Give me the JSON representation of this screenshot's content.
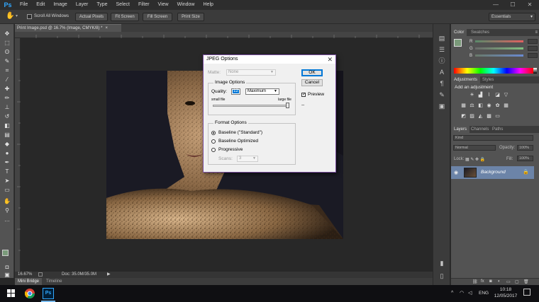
{
  "menubar": {
    "logo": "Ps",
    "items": [
      "File",
      "Edit",
      "Image",
      "Layer",
      "Type",
      "Select",
      "Filter",
      "View",
      "Window",
      "Help"
    ],
    "minimize": "—",
    "maximize": "☐",
    "close": "✕"
  },
  "options_bar": {
    "scroll_all_label": "Scroll All Windows",
    "buttons": [
      "Actual Pixels",
      "Fit Screen",
      "Fill Screen",
      "Print Size"
    ],
    "workspace": "Essentials"
  },
  "document": {
    "tab_title": "Print Image.psd @ 16.7% (Image, CMYK/8) *",
    "zoom": "16.67%",
    "doc_info": "Doc: 35.0M/35.0M"
  },
  "bottom_tabs": [
    "Mini Bridge",
    "Timeline"
  ],
  "colors": {
    "accent": "#31a8ff",
    "dialog_border": "#7a4fa0",
    "layer_selected": "#6c84a8"
  },
  "panels": {
    "color_tabs": [
      "Color",
      "Swatches"
    ],
    "sliders": [
      "R",
      "G",
      "B"
    ],
    "adjust_tabs": [
      "Adjustments",
      "Styles"
    ],
    "adjust_heading": "Add an adjustment",
    "layers_tabs": [
      "Layers",
      "Channels",
      "Paths"
    ],
    "kind": "Kind",
    "blend": "Normal",
    "opacity_label": "Opacity:",
    "opacity_value": "100%",
    "lock_label": "Lock:",
    "fill_label": "Fill:",
    "fill_value": "100%",
    "layer_name": "Background"
  },
  "dialog": {
    "title": "JPEG Options",
    "matte_label": "Matte:",
    "matte_value": "None",
    "ok": "OK",
    "cancel": "Cancel",
    "preview_label": "Preview",
    "image_options_legend": "Image Options",
    "quality_label": "Quality:",
    "quality_value": "12",
    "quality_preset": "Maximum",
    "small_file": "small file",
    "large_file": "large file",
    "slider_fraction": 1.0,
    "size_readout": "--",
    "format_legend": "Format Options",
    "formats": [
      "Baseline (\"Standard\")",
      "Baseline Optimized",
      "Progressive"
    ],
    "scans_label": "Scans:",
    "scans_value": "3"
  },
  "taskbar": {
    "language": "ENG",
    "time": "10:18",
    "date": "12/05/2017",
    "tray_arrow": "^"
  }
}
